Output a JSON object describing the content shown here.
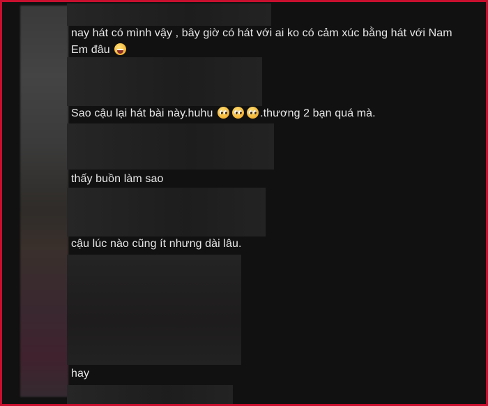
{
  "comments": [
    {
      "line1": "nay hát có mình vậy , bây giờ có hát với ai ko có cảm xúc bằng hát với Nam",
      "line2": "Em đâu",
      "emoji": "grinning-face-icon"
    },
    {
      "text_before": "Sao cậu lại hát bài này.huhu",
      "text_after": ".thương 2 bạn quá mà.",
      "emoji": "pleading-face-icon"
    },
    {
      "text": "thấy buồn làm sao"
    },
    {
      "text": "cậu lúc nào cũng ít nhưng dài lâu."
    },
    {
      "text": "hay"
    }
  ],
  "colors": {
    "frame_border": "#c8102e",
    "background": "#111111",
    "text": "#e8e8e8"
  }
}
